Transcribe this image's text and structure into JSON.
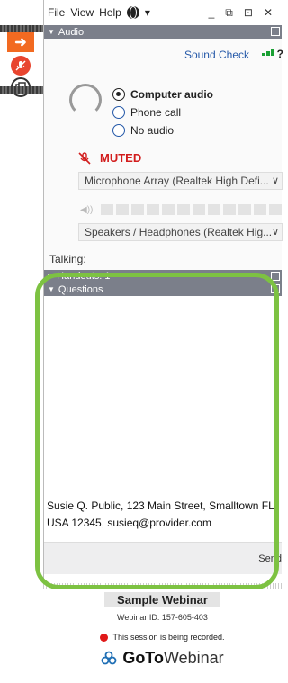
{
  "menu": {
    "file": "File",
    "view": "View",
    "help": "Help"
  },
  "window_controls": [
    "_",
    "⧉",
    "⊡",
    "✕"
  ],
  "audio": {
    "header": "Audio",
    "sound_check": "Sound Check",
    "options": [
      {
        "label": "Computer audio",
        "selected": true
      },
      {
        "label": "Phone call",
        "selected": false
      },
      {
        "label": "No audio",
        "selected": false
      }
    ],
    "muted_label": "MUTED",
    "microphone": "Microphone Array (Realtek High Defi...",
    "speakers": "Speakers / Headphones (Realtek Hig...",
    "talking_label": "Talking:"
  },
  "handouts": {
    "label": "Handouts: 1"
  },
  "questions": {
    "header": "Questions",
    "input_value": "Susie Q. Public, 123 Main Street, Smalltown FL USA 12345, susieq@provider.com",
    "send_label": "Send"
  },
  "footer": {
    "webinar_title": "Sample Webinar",
    "webinar_id": "Webinar ID: 157-605-403",
    "recording_notice": "This session is being recorded.",
    "brand_goto": "GoTo",
    "brand_webinar": "Webinar"
  },
  "colors": {
    "accent_orange": "#f26a21",
    "muted_red": "#d21d1d",
    "highlight_green": "#7dc242",
    "header_gray": "#7b7f8a",
    "link_blue": "#2458a8"
  }
}
